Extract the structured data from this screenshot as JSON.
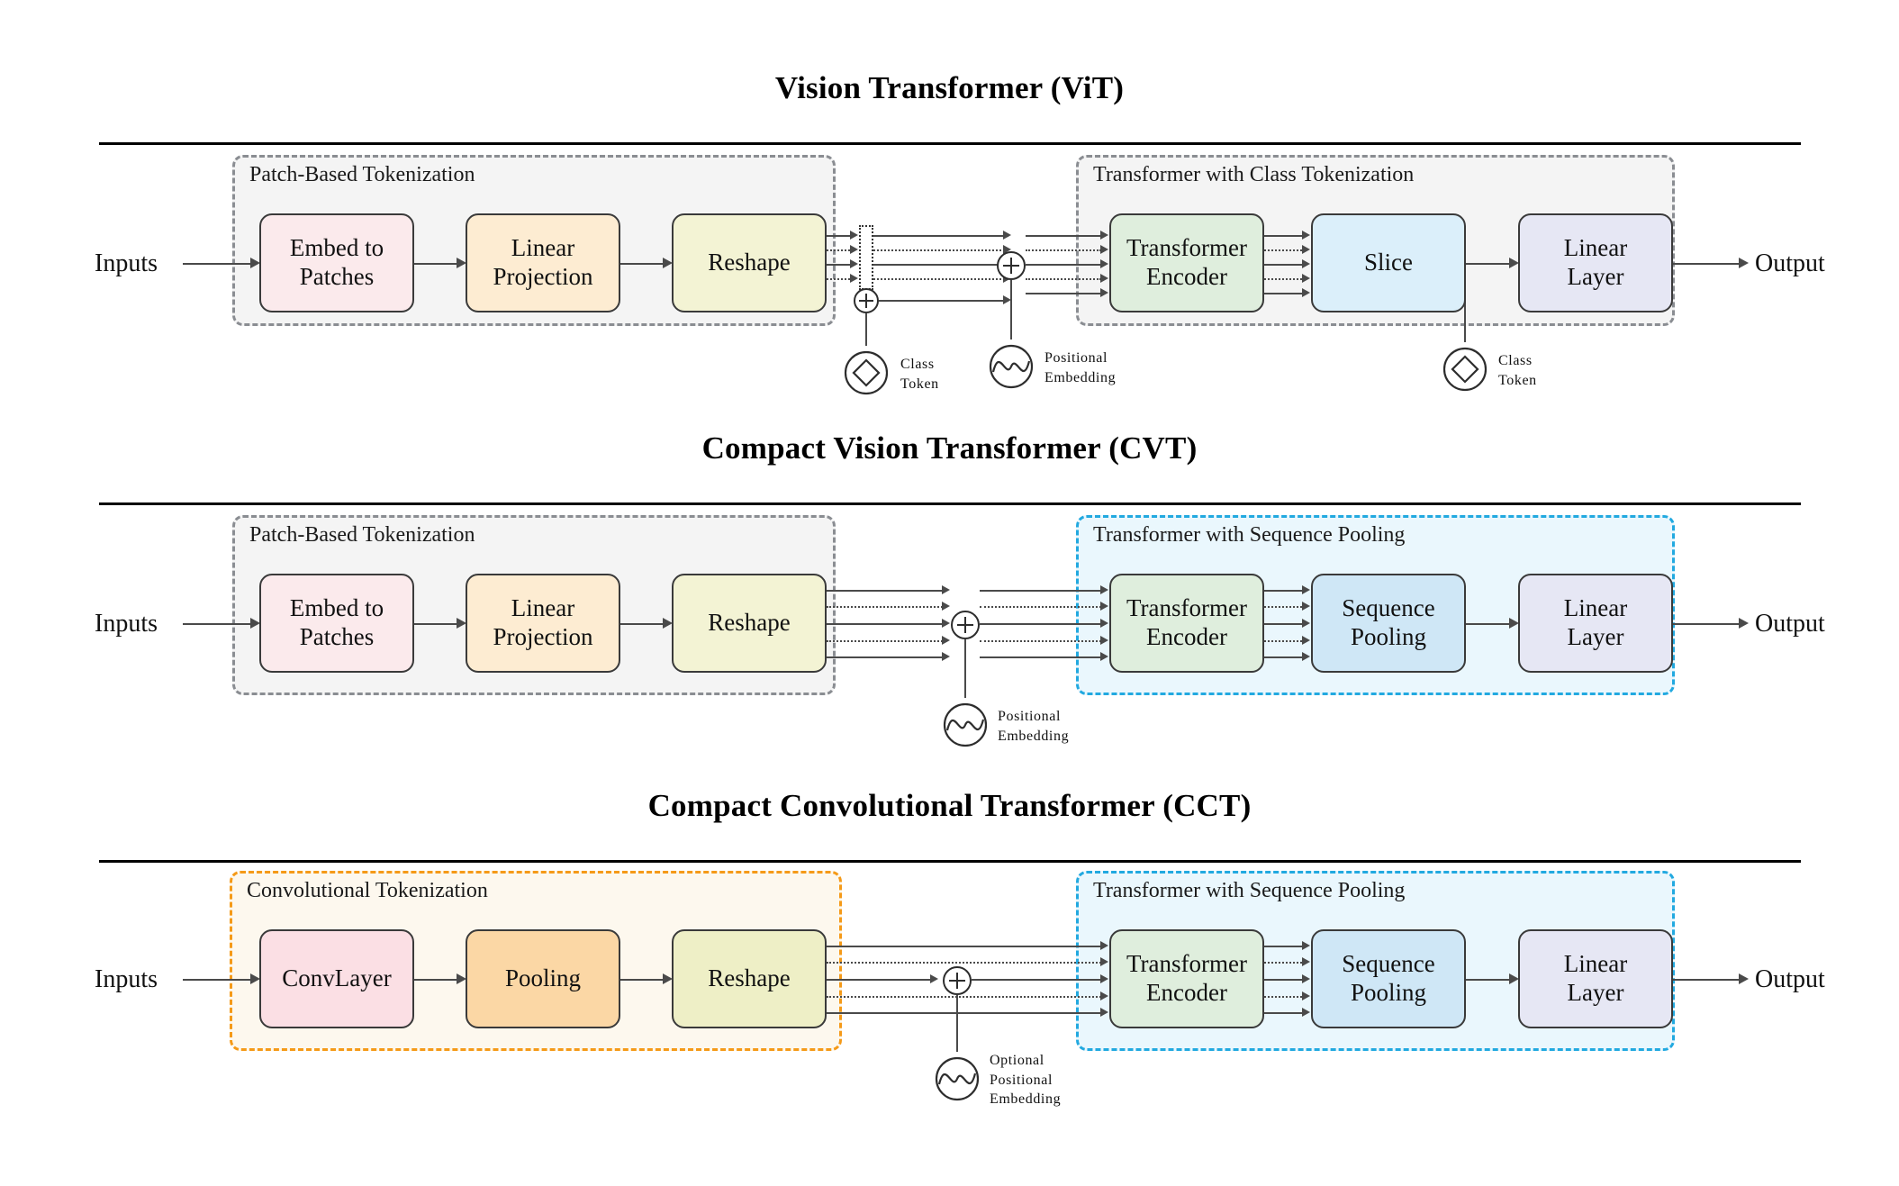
{
  "figure": {
    "type": "architecture-diagram",
    "rows": [
      {
        "id": "vit",
        "title": "Vision Transformer (ViT)",
        "input_label": "Inputs",
        "output_label": "Output",
        "groups": [
          {
            "id": "vit-tokenization",
            "label": "Patch-Based Tokenization",
            "style": "gray",
            "nodes": [
              "Embed to Patches",
              "Linear Projection",
              "Reshape"
            ]
          },
          {
            "id": "vit-transformer",
            "label": "Transformer with Class Tokenization",
            "style": "gray",
            "nodes": [
              "Transformer Encoder",
              "Slice",
              "Linear Layer"
            ]
          }
        ],
        "nodes": [
          {
            "id": "vit-embed",
            "line1": "Embed to",
            "line2": "Patches",
            "color": "#fbeaec"
          },
          {
            "id": "vit-linproj",
            "line1": "Linear",
            "line2": "Projection",
            "color": "#fdecd2"
          },
          {
            "id": "vit-reshape",
            "line1": "Reshape",
            "line2": "",
            "color": "#f3f3d4"
          },
          {
            "id": "vit-encoder",
            "line1": "Transformer",
            "line2": "Encoder",
            "color": "#dfeedd"
          },
          {
            "id": "vit-slice",
            "line1": "Slice",
            "line2": "",
            "color": "#dbeffa"
          },
          {
            "id": "vit-linear",
            "line1": "Linear",
            "line2": "Layer",
            "color": "#e6e7f4"
          }
        ],
        "symbols": [
          {
            "id": "vit-class-token-in",
            "icon": "class-token-icon",
            "label_line1": "Class",
            "label_line2": "Token",
            "label_line3": ""
          },
          {
            "id": "vit-pos-embed",
            "icon": "positional-embedding-icon",
            "label_line1": "Positional",
            "label_line2": "Embedding",
            "label_line3": ""
          },
          {
            "id": "vit-class-token-out",
            "icon": "class-token-icon",
            "label_line1": "Class",
            "label_line2": "Token",
            "label_line3": ""
          }
        ]
      },
      {
        "id": "cvt",
        "title": "Compact Vision Transformer (CVT)",
        "input_label": "Inputs",
        "output_label": "Output",
        "groups": [
          {
            "id": "cvt-tokenization",
            "label": "Patch-Based Tokenization",
            "style": "gray",
            "nodes": [
              "Embed to Patches",
              "Linear Projection",
              "Reshape"
            ]
          },
          {
            "id": "cvt-transformer",
            "label": "Transformer with Sequence Pooling",
            "style": "blue",
            "nodes": [
              "Transformer Encoder",
              "Sequence Pooling",
              "Linear Layer"
            ]
          }
        ],
        "nodes": [
          {
            "id": "cvt-embed",
            "line1": "Embed to",
            "line2": "Patches",
            "color": "#fbeaec"
          },
          {
            "id": "cvt-linproj",
            "line1": "Linear",
            "line2": "Projection",
            "color": "#fdecd2"
          },
          {
            "id": "cvt-reshape",
            "line1": "Reshape",
            "line2": "",
            "color": "#f3f3d4"
          },
          {
            "id": "cvt-encoder",
            "line1": "Transformer",
            "line2": "Encoder",
            "color": "#dfeedd"
          },
          {
            "id": "cvt-seqpool",
            "line1": "Sequence",
            "line2": "Pooling",
            "color": "#cfe7f6"
          },
          {
            "id": "cvt-linear",
            "line1": "Linear",
            "line2": "Layer",
            "color": "#e6e7f4"
          }
        ],
        "symbols": [
          {
            "id": "cvt-pos-embed",
            "icon": "positional-embedding-icon",
            "label_line1": "Positional",
            "label_line2": "Embedding",
            "label_line3": ""
          }
        ]
      },
      {
        "id": "cct",
        "title": "Compact Convolutional Transformer (CCT)",
        "input_label": "Inputs",
        "output_label": "Output",
        "groups": [
          {
            "id": "cct-tokenization",
            "label": "Convolutional Tokenization",
            "style": "orange",
            "nodes": [
              "ConvLayer",
              "Pooling",
              "Reshape"
            ]
          },
          {
            "id": "cct-transformer",
            "label": "Transformer with Sequence Pooling",
            "style": "blue",
            "nodes": [
              "Transformer Encoder",
              "Sequence Pooling",
              "Linear Layer"
            ]
          }
        ],
        "nodes": [
          {
            "id": "cct-conv",
            "line1": "ConvLayer",
            "line2": "",
            "color": "#fbdfe4"
          },
          {
            "id": "cct-pooling",
            "line1": "Pooling",
            "line2": "",
            "color": "#fbd7a5"
          },
          {
            "id": "cct-reshape",
            "line1": "Reshape",
            "line2": "",
            "color": "#eeefc6"
          },
          {
            "id": "cct-encoder",
            "line1": "Transformer",
            "line2": "Encoder",
            "color": "#dfeedd"
          },
          {
            "id": "cct-seqpool",
            "line1": "Sequence",
            "line2": "Pooling",
            "color": "#cfe7f6"
          },
          {
            "id": "cct-linear",
            "line1": "Linear",
            "line2": "Layer",
            "color": "#e6e7f4"
          }
        ],
        "symbols": [
          {
            "id": "cct-pos-embed",
            "icon": "positional-embedding-icon",
            "label_line1": "Optional",
            "label_line2": "Positional",
            "label_line3": "Embedding"
          }
        ]
      }
    ],
    "colors": {
      "group_gray_border": "#8a8d92",
      "group_gray_fill": "#f4f4f4",
      "group_blue_border": "#22a9e0",
      "group_blue_fill": "#eaf7fd",
      "group_orange_border": "#f59a18",
      "group_orange_fill": "#fdf8ee",
      "line": "#4a4a4a",
      "rule": "#000000"
    }
  }
}
